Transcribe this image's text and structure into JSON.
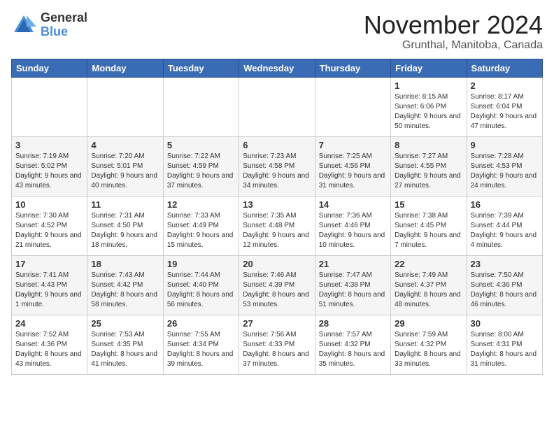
{
  "header": {
    "logo_general": "General",
    "logo_blue": "Blue",
    "month_title": "November 2024",
    "location": "Grunthal, Manitoba, Canada"
  },
  "days_of_week": [
    "Sunday",
    "Monday",
    "Tuesday",
    "Wednesday",
    "Thursday",
    "Friday",
    "Saturday"
  ],
  "weeks": [
    [
      {
        "day": "",
        "info": ""
      },
      {
        "day": "",
        "info": ""
      },
      {
        "day": "",
        "info": ""
      },
      {
        "day": "",
        "info": ""
      },
      {
        "day": "",
        "info": ""
      },
      {
        "day": "1",
        "info": "Sunrise: 8:15 AM\nSunset: 6:06 PM\nDaylight: 9 hours and 50 minutes."
      },
      {
        "day": "2",
        "info": "Sunrise: 8:17 AM\nSunset: 6:04 PM\nDaylight: 9 hours and 47 minutes."
      }
    ],
    [
      {
        "day": "3",
        "info": "Sunrise: 7:19 AM\nSunset: 5:02 PM\nDaylight: 9 hours and 43 minutes."
      },
      {
        "day": "4",
        "info": "Sunrise: 7:20 AM\nSunset: 5:01 PM\nDaylight: 9 hours and 40 minutes."
      },
      {
        "day": "5",
        "info": "Sunrise: 7:22 AM\nSunset: 4:59 PM\nDaylight: 9 hours and 37 minutes."
      },
      {
        "day": "6",
        "info": "Sunrise: 7:23 AM\nSunset: 4:58 PM\nDaylight: 9 hours and 34 minutes."
      },
      {
        "day": "7",
        "info": "Sunrise: 7:25 AM\nSunset: 4:56 PM\nDaylight: 9 hours and 31 minutes."
      },
      {
        "day": "8",
        "info": "Sunrise: 7:27 AM\nSunset: 4:55 PM\nDaylight: 9 hours and 27 minutes."
      },
      {
        "day": "9",
        "info": "Sunrise: 7:28 AM\nSunset: 4:53 PM\nDaylight: 9 hours and 24 minutes."
      }
    ],
    [
      {
        "day": "10",
        "info": "Sunrise: 7:30 AM\nSunset: 4:52 PM\nDaylight: 9 hours and 21 minutes."
      },
      {
        "day": "11",
        "info": "Sunrise: 7:31 AM\nSunset: 4:50 PM\nDaylight: 9 hours and 18 minutes."
      },
      {
        "day": "12",
        "info": "Sunrise: 7:33 AM\nSunset: 4:49 PM\nDaylight: 9 hours and 15 minutes."
      },
      {
        "day": "13",
        "info": "Sunrise: 7:35 AM\nSunset: 4:48 PM\nDaylight: 9 hours and 12 minutes."
      },
      {
        "day": "14",
        "info": "Sunrise: 7:36 AM\nSunset: 4:46 PM\nDaylight: 9 hours and 10 minutes."
      },
      {
        "day": "15",
        "info": "Sunrise: 7:38 AM\nSunset: 4:45 PM\nDaylight: 9 hours and 7 minutes."
      },
      {
        "day": "16",
        "info": "Sunrise: 7:39 AM\nSunset: 4:44 PM\nDaylight: 9 hours and 4 minutes."
      }
    ],
    [
      {
        "day": "17",
        "info": "Sunrise: 7:41 AM\nSunset: 4:43 PM\nDaylight: 9 hours and 1 minute."
      },
      {
        "day": "18",
        "info": "Sunrise: 7:43 AM\nSunset: 4:42 PM\nDaylight: 8 hours and 58 minutes."
      },
      {
        "day": "19",
        "info": "Sunrise: 7:44 AM\nSunset: 4:40 PM\nDaylight: 8 hours and 56 minutes."
      },
      {
        "day": "20",
        "info": "Sunrise: 7:46 AM\nSunset: 4:39 PM\nDaylight: 8 hours and 53 minutes."
      },
      {
        "day": "21",
        "info": "Sunrise: 7:47 AM\nSunset: 4:38 PM\nDaylight: 8 hours and 51 minutes."
      },
      {
        "day": "22",
        "info": "Sunrise: 7:49 AM\nSunset: 4:37 PM\nDaylight: 8 hours and 48 minutes."
      },
      {
        "day": "23",
        "info": "Sunrise: 7:50 AM\nSunset: 4:36 PM\nDaylight: 8 hours and 46 minutes."
      }
    ],
    [
      {
        "day": "24",
        "info": "Sunrise: 7:52 AM\nSunset: 4:36 PM\nDaylight: 8 hours and 43 minutes."
      },
      {
        "day": "25",
        "info": "Sunrise: 7:53 AM\nSunset: 4:35 PM\nDaylight: 8 hours and 41 minutes."
      },
      {
        "day": "26",
        "info": "Sunrise: 7:55 AM\nSunset: 4:34 PM\nDaylight: 8 hours and 39 minutes."
      },
      {
        "day": "27",
        "info": "Sunrise: 7:56 AM\nSunset: 4:33 PM\nDaylight: 8 hours and 37 minutes."
      },
      {
        "day": "28",
        "info": "Sunrise: 7:57 AM\nSunset: 4:32 PM\nDaylight: 8 hours and 35 minutes."
      },
      {
        "day": "29",
        "info": "Sunrise: 7:59 AM\nSunset: 4:32 PM\nDaylight: 8 hours and 33 minutes."
      },
      {
        "day": "30",
        "info": "Sunrise: 8:00 AM\nSunset: 4:31 PM\nDaylight: 8 hours and 31 minutes."
      }
    ]
  ]
}
